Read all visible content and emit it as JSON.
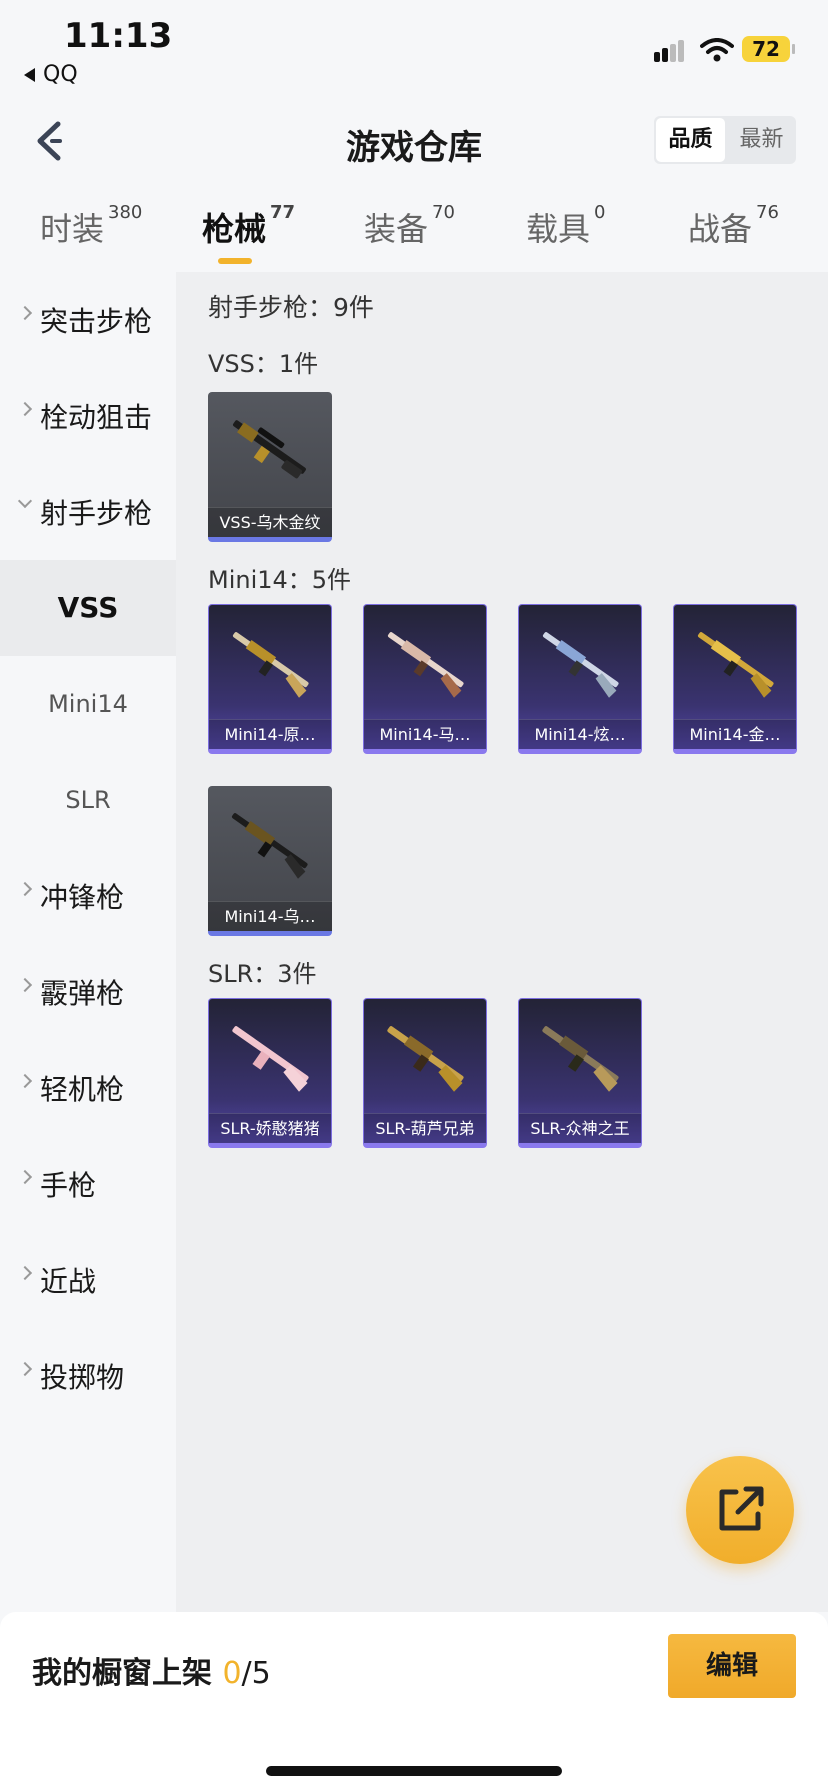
{
  "status": {
    "time": "11:13",
    "back_app": "QQ",
    "battery": "72"
  },
  "header": {
    "title": "游戏仓库",
    "sort_quality": "品质",
    "sort_newest": "最新"
  },
  "tabs": [
    {
      "label": "时装",
      "count": "380"
    },
    {
      "label": "枪械",
      "count": "77"
    },
    {
      "label": "装备",
      "count": "70"
    },
    {
      "label": "载具",
      "count": "0"
    },
    {
      "label": "战备",
      "count": "76"
    }
  ],
  "sidebar": {
    "items": [
      {
        "label": "突击步枪"
      },
      {
        "label": "栓动狙击"
      },
      {
        "label": "射手步枪"
      },
      {
        "label": "冲锋枪"
      },
      {
        "label": "霰弹枪"
      },
      {
        "label": "轻机枪"
      },
      {
        "label": "手枪"
      },
      {
        "label": "近战"
      },
      {
        "label": "投掷物"
      }
    ],
    "sub": [
      {
        "label": "VSS"
      },
      {
        "label": "Mini14"
      },
      {
        "label": "SLR"
      }
    ]
  },
  "content": {
    "category_title": "射手步枪：9件",
    "sections": [
      {
        "title": "VSS：1件",
        "items": [
          {
            "name": "VSS-乌木金纹"
          }
        ]
      },
      {
        "title": "Mini14：5件",
        "items": [
          {
            "name": "Mini14-原…"
          },
          {
            "name": "Mini14-马…"
          },
          {
            "name": "Mini14-炫…"
          },
          {
            "name": "Mini14-金…"
          },
          {
            "name": "Mini14-乌…"
          }
        ]
      },
      {
        "title": "SLR：3件",
        "items": [
          {
            "name": "SLR-娇憨猪猪"
          },
          {
            "name": "SLR-葫芦兄弟"
          },
          {
            "name": "SLR-众神之王"
          }
        ]
      }
    ]
  },
  "bottom": {
    "showcase_label": "我的橱窗上架 ",
    "showcase_count": "0",
    "showcase_total": "/5",
    "edit_label": "编辑"
  },
  "colors": {
    "accent": "#f2b32c",
    "purple_card": "#3a3370",
    "gray_card": "#4c4e55"
  }
}
